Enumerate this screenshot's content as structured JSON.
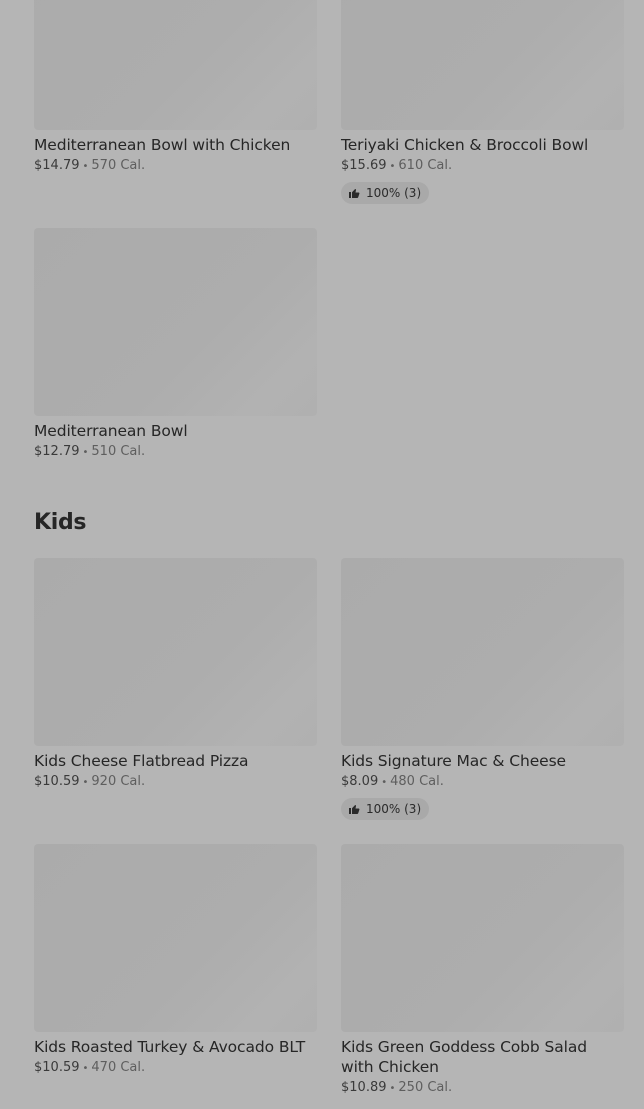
{
  "sections": {
    "bowls": {
      "items": [
        {
          "name": "Mediterranean Bowl with Chicken",
          "price": "$14.79",
          "calories": "570 Cal."
        },
        {
          "name": "Teriyaki Chicken & Broccoli Bowl",
          "price": "$15.69",
          "calories": "610 Cal.",
          "rating": "100% (3)"
        },
        {
          "name": "Mediterranean Bowl",
          "price": "$12.79",
          "calories": "510 Cal."
        }
      ]
    },
    "kids": {
      "title": "Kids",
      "items": [
        {
          "name": "Kids Cheese Flatbread Pizza",
          "price": "$10.59",
          "calories": "920 Cal."
        },
        {
          "name": "Kids Signature Mac & Cheese",
          "price": "$8.09",
          "calories": "480 Cal.",
          "rating": "100% (3)"
        },
        {
          "name": "Kids Roasted Turkey & Avocado BLT",
          "price": "$10.59",
          "calories": "470 Cal."
        },
        {
          "name": "Kids Green Goddess Cobb Salad with Chicken",
          "price": "$10.89",
          "calories": "250 Cal."
        }
      ]
    }
  },
  "separator": "•",
  "icons": {
    "rating": "thumbs-up-icon"
  }
}
